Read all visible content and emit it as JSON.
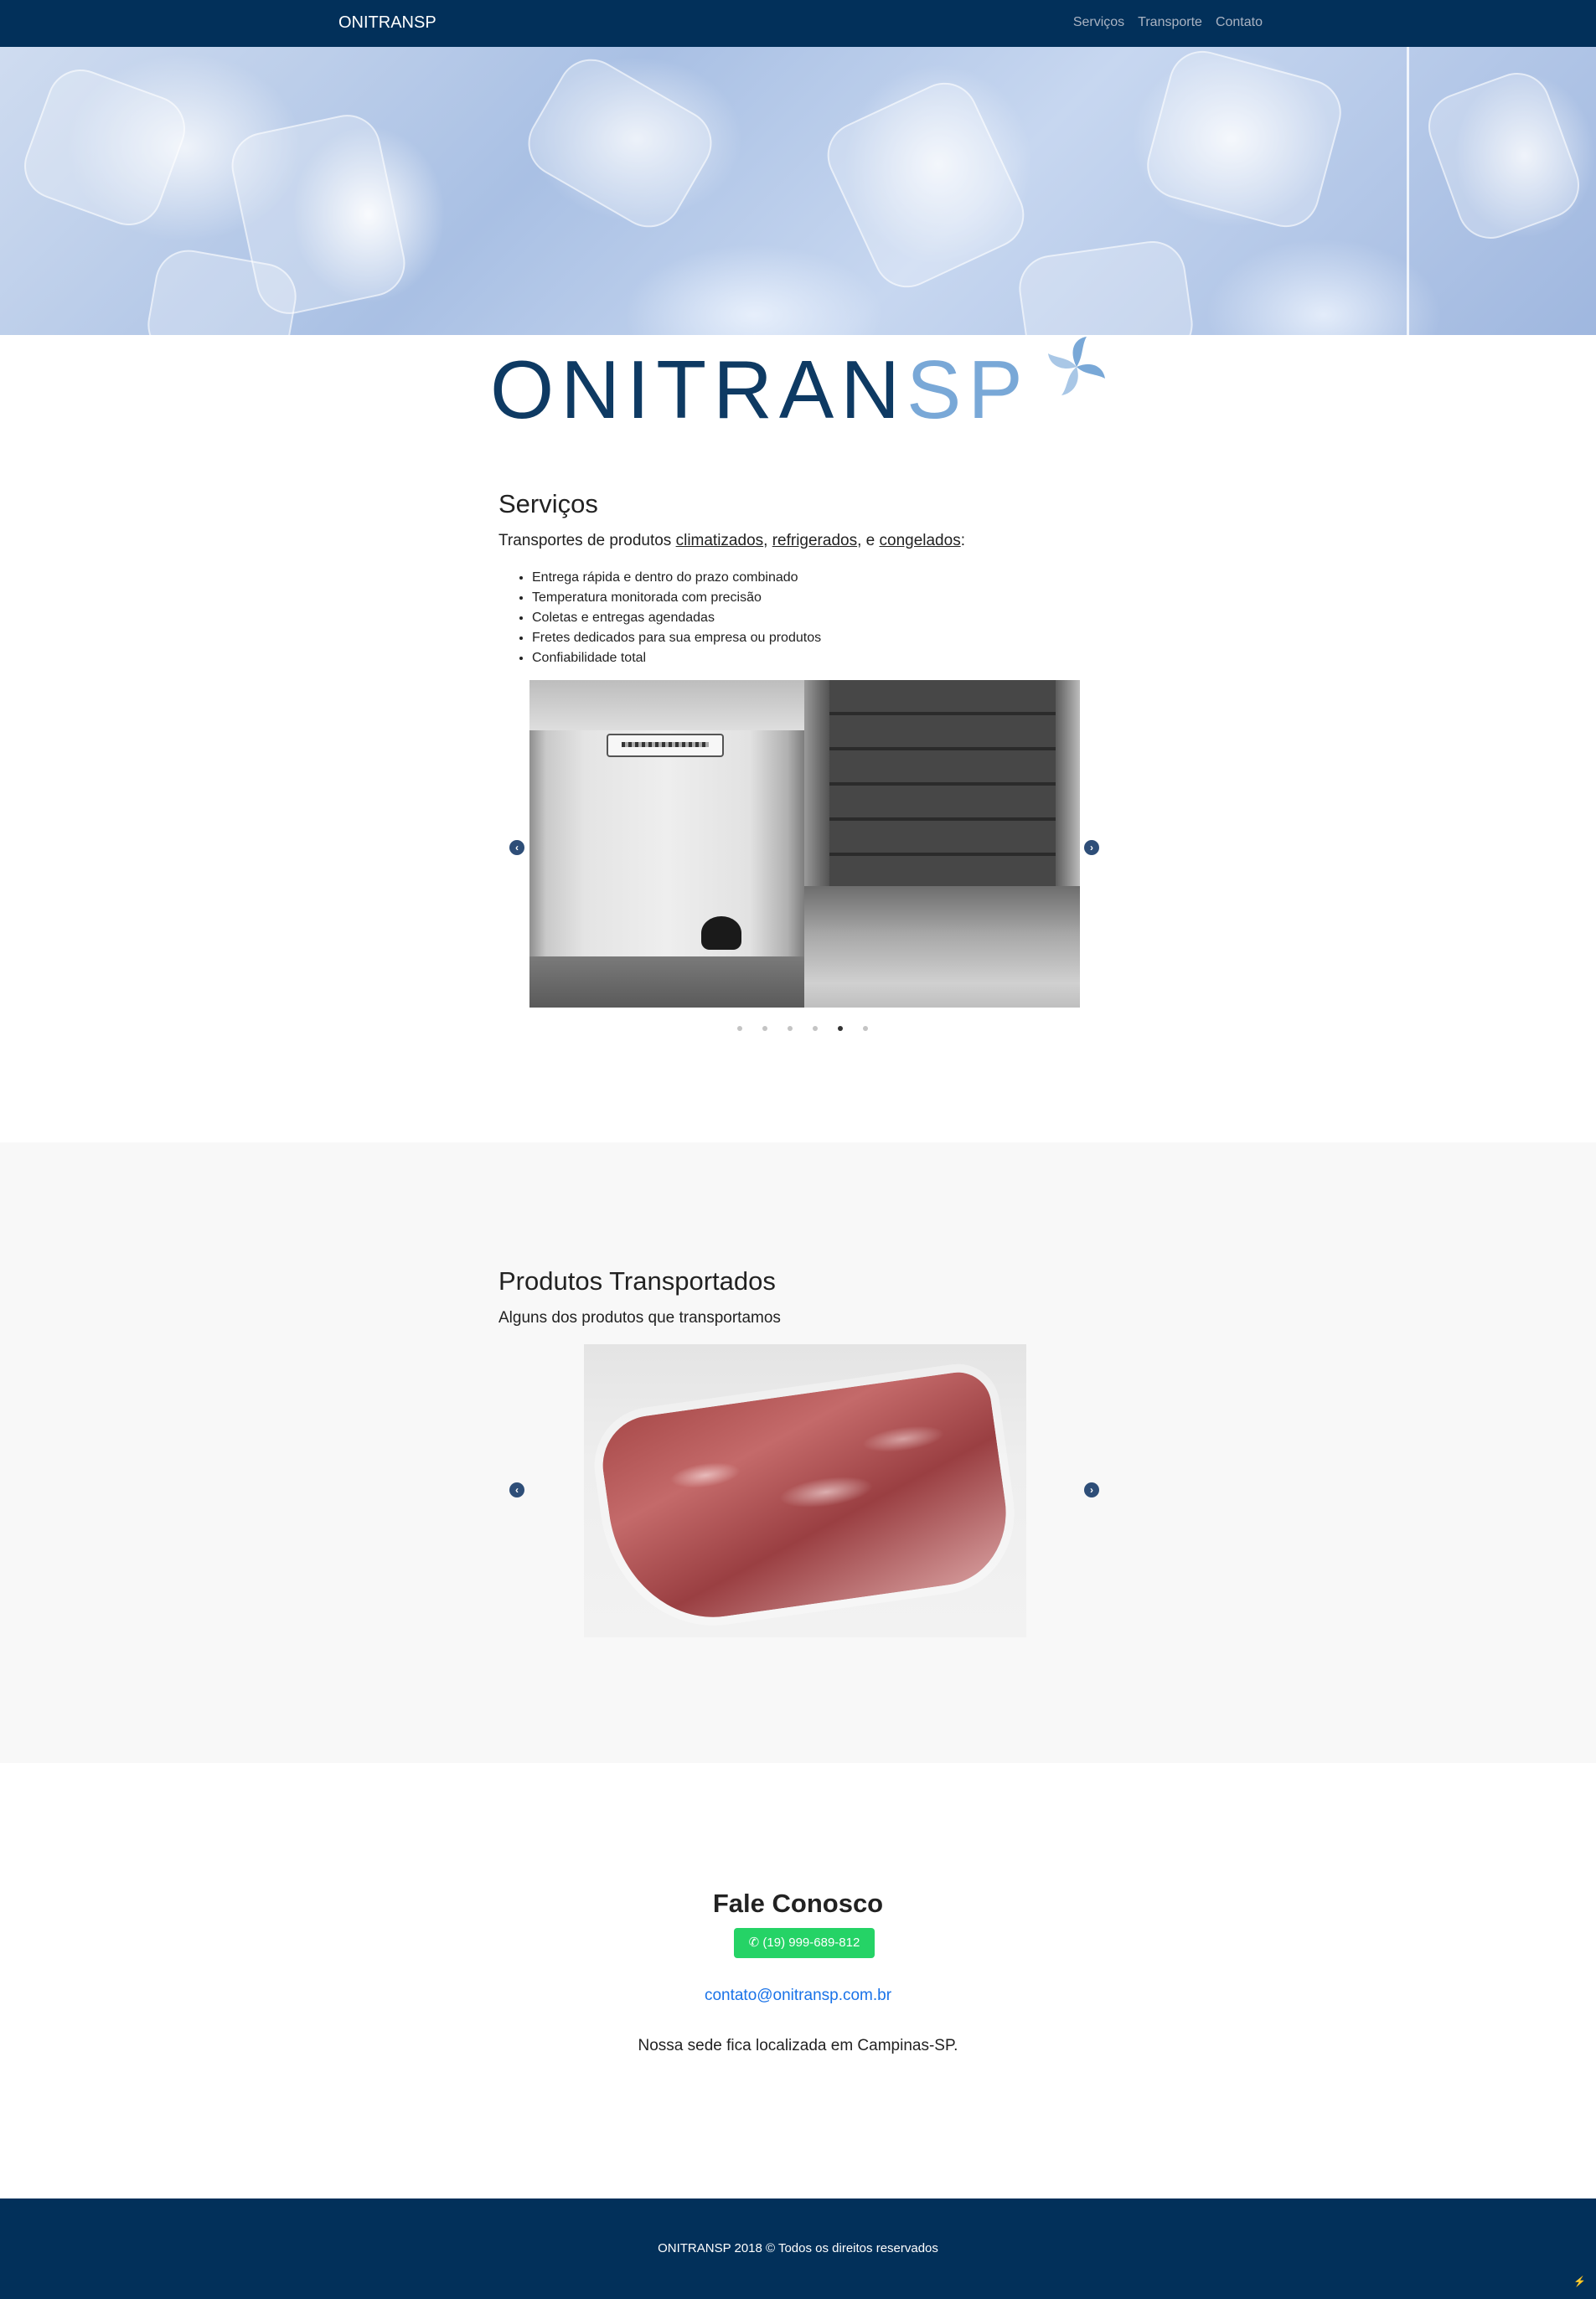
{
  "nav": {
    "brand": "ONITRANSP",
    "links": [
      "Serviços",
      "Transporte",
      "Contato"
    ]
  },
  "logo": {
    "part1": "ONITRAN",
    "part2": "SP",
    "colors": {
      "dark": "#0e3a63",
      "light": "#79a8d7"
    }
  },
  "services": {
    "title": "Serviços",
    "subtitle_prefix": "Transportes de produtos ",
    "link1": "climatizados",
    "sep1": ", ",
    "link2": "refrigerados",
    "sep2": ", e ",
    "link3": "congelados",
    "suffix": ":",
    "bullets": [
      "Entrega rápida e dentro do prazo combinado",
      "Temperatura monitorada com precisão",
      "Coletas e entregas agendadas",
      "Fretes dedicados para sua empresa ou produtos",
      "Confiabilidade total"
    ],
    "carousel": {
      "slide_count": 6,
      "active_index": 4,
      "prev_icon": "chevron-left-icon",
      "next_icon": "chevron-right-icon"
    }
  },
  "products": {
    "title": "Produtos Transportados",
    "subtitle": "Alguns dos produtos que transportamos"
  },
  "contact": {
    "title": "Fale Conosco",
    "whatsapp": "(19) 999-689-812",
    "email": "contato@onitransp.com.br",
    "address": "Nossa sede fica localizada em Campinas-SP."
  },
  "footer": {
    "copyright": "ONITRANSP 2018 © Todos os direitos reservados",
    "corner": "⚡"
  },
  "colors": {
    "navbar": "#02305a",
    "whatsapp": "#25d366",
    "link": "#1a73e8",
    "section_gray": "#f8f8f8"
  }
}
